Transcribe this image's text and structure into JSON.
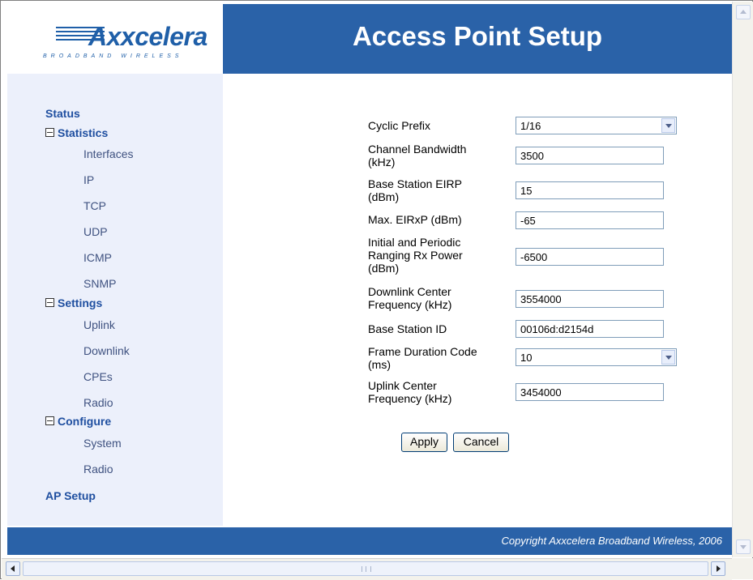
{
  "header": {
    "logo_text": "Axxcelera",
    "logo_tagline": "BROADBAND WIRELESS",
    "title": "Access Point Setup"
  },
  "sidebar": {
    "status": "Status",
    "statistics": {
      "label": "Statistics",
      "items": [
        "Interfaces",
        "IP",
        "TCP",
        "UDP",
        "ICMP",
        "SNMP"
      ]
    },
    "settings": {
      "label": "Settings",
      "items": [
        "Uplink",
        "Downlink",
        "CPEs",
        "Radio"
      ]
    },
    "configure": {
      "label": "Configure",
      "items": [
        "System",
        "Radio"
      ]
    },
    "ap_setup": "AP Setup"
  },
  "form": {
    "cyclic_prefix": {
      "label": "Cyclic Prefix",
      "value": "1/16"
    },
    "channel_bandwidth": {
      "label_1": "Channel Bandwidth",
      "label_2": "(kHz)",
      "value": "3500"
    },
    "bs_eirp": {
      "label_1": "Base Station EIRP",
      "label_2": "(dBm)",
      "value": "15"
    },
    "max_eirxp": {
      "label": "Max. EIRxP (dBm)",
      "value": "-65"
    },
    "ranging": {
      "label_1": "Initial and Periodic",
      "label_2": "Ranging Rx Power",
      "label_3": "(dBm)",
      "value": "-6500"
    },
    "downlink_freq": {
      "label_1": "Downlink Center",
      "label_2": "Frequency (kHz)",
      "value": "3554000"
    },
    "bs_id": {
      "label": "Base Station ID",
      "value": "00106d:d2154d"
    },
    "frame_duration": {
      "label_1": "Frame Duration Code",
      "label_2": "(ms)",
      "value": "10"
    },
    "uplink_freq": {
      "label_1": "Uplink Center",
      "label_2": "Frequency (kHz)",
      "value": "3454000"
    },
    "apply_label": "Apply",
    "cancel_label": "Cancel"
  },
  "footer": {
    "copyright": "Copyright Axxcelera Broadband Wireless, 2006"
  },
  "colors": {
    "header_blue": "#2a62a8",
    "sidebar_bg": "#ecf0fb",
    "nav_blue": "#1f4fa0"
  }
}
